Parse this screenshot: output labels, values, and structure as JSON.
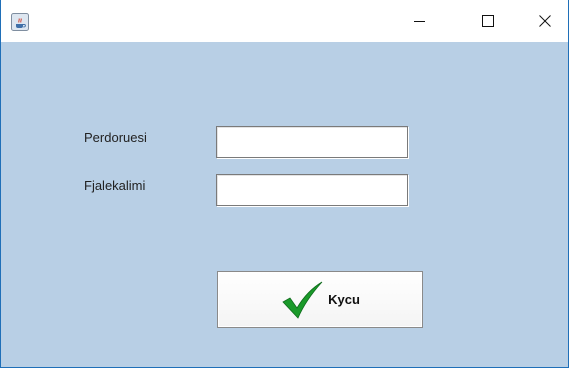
{
  "window": {
    "icon": "java-cup-icon",
    "controls": [
      "minimize-icon",
      "maximize-icon",
      "close-icon"
    ]
  },
  "form": {
    "username_label": "Perdoruesi",
    "username_value": "",
    "password_label": "Fjalekalimi",
    "password_value": ""
  },
  "login_button": {
    "label": "Kycu",
    "icon": "checkmark-icon",
    "icon_color": "#1a9a2a"
  },
  "colors": {
    "content_background": "#b8cfe5"
  }
}
